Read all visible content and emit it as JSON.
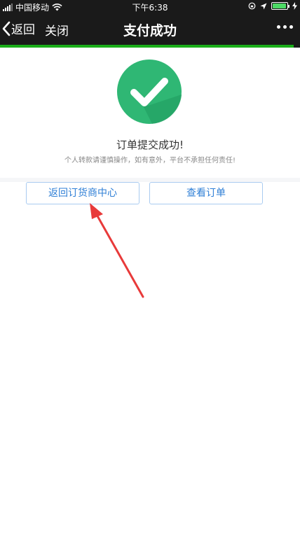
{
  "status_bar": {
    "carrier": "中国移动",
    "time": "下午6:38",
    "battery_level": 0.95,
    "battery_color": "#4cd964"
  },
  "nav": {
    "back_label": "返回",
    "close_label": "关闭",
    "title": "支付成功",
    "more_icon": "more-dots-icon"
  },
  "page_load_progress": 0.98,
  "result": {
    "icon": "check-circle-icon",
    "icon_color": "#2fb774",
    "title": "订单提交成功!",
    "note": "个人转款请谨慎操作，如有意外，平台不承担任何责任!"
  },
  "buttons": {
    "back_to_center": "返回订货商中心",
    "view_order": "查看订单"
  },
  "colors": {
    "nav_bg": "#1a1a1a",
    "accent_blue": "#2f7fd6",
    "progress_green": "#1aad19",
    "annotation_arrow": "#e83a3a"
  }
}
